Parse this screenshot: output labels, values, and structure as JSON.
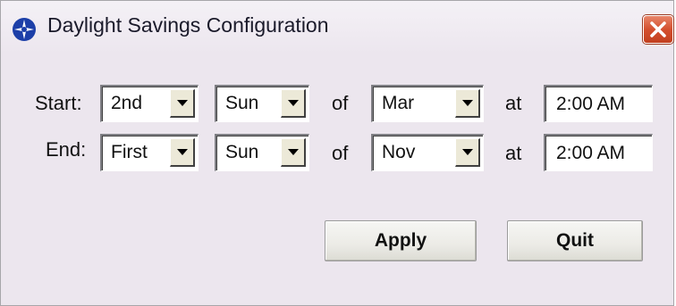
{
  "window": {
    "title": "Daylight Savings Configuration",
    "icon": "app-logo-icon",
    "close_icon": "close-icon"
  },
  "start": {
    "label": "Start:",
    "week": "2nd",
    "day": "Sun",
    "of_label": "of",
    "month": "Mar",
    "at_label": "at",
    "time": "2:00 AM"
  },
  "end": {
    "label": "End:",
    "week": "First",
    "day": "Sun",
    "of_label": "of",
    "month": "Nov",
    "at_label": "at",
    "time": "2:00 AM"
  },
  "buttons": {
    "apply": "Apply",
    "quit": "Quit"
  },
  "colors": {
    "window_bg": "#ece6ee",
    "close_button": "#d4502f",
    "logo_blue": "#1c3fa8"
  }
}
